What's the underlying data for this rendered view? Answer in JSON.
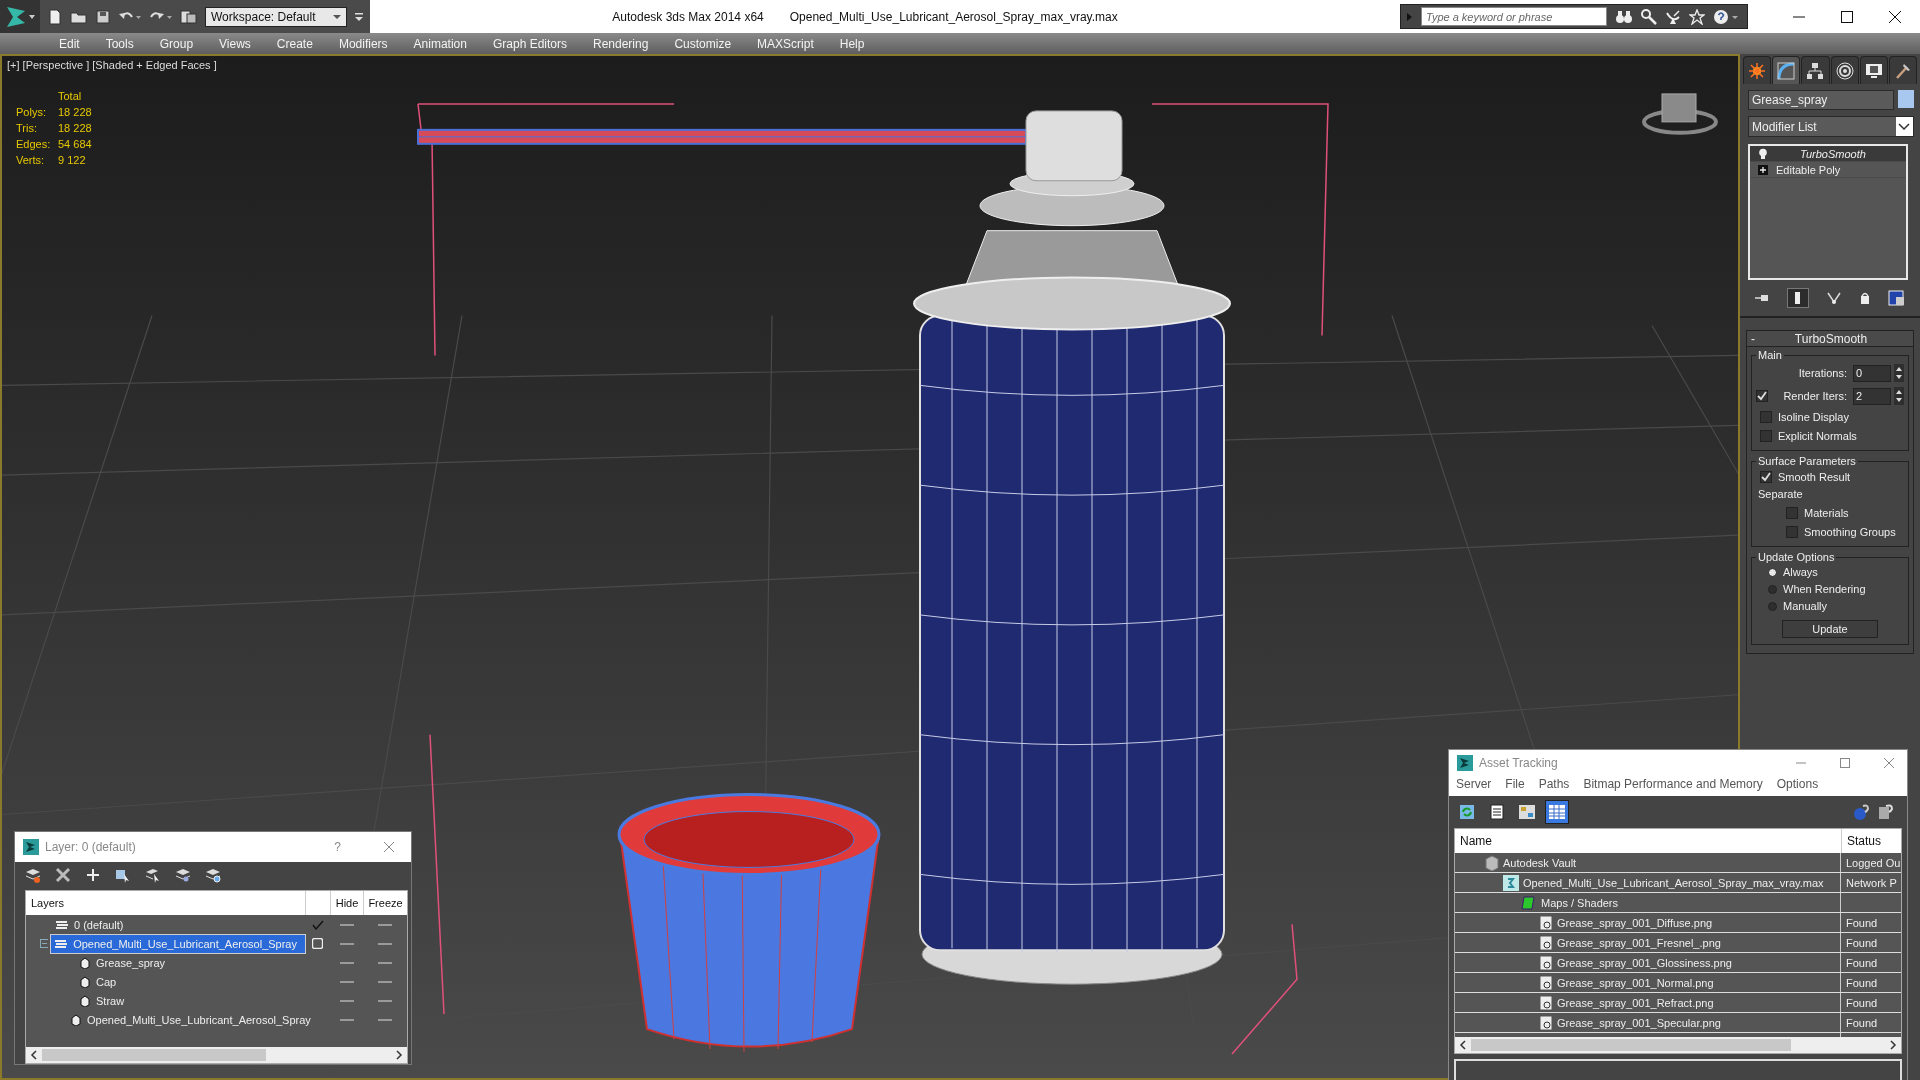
{
  "title_bar": {
    "app": "Autodesk 3ds Max  2014 x64",
    "file": "Opened_Multi_Use_Lubricant_Aerosol_Spray_max_vray.max",
    "workspace": "Workspace: Default",
    "search": {
      "placeholder": "Type a keyword or phrase"
    }
  },
  "menu": [
    "Edit",
    "Tools",
    "Group",
    "Views",
    "Create",
    "Modifiers",
    "Animation",
    "Graph Editors",
    "Rendering",
    "Customize",
    "MAXScript",
    "Help"
  ],
  "viewport": {
    "label": "[+] [Perspective ] [Shaded + Edged Faces ]",
    "stats": {
      "header": "Total",
      "rows": [
        {
          "label": "Polys:",
          "value": "18 228"
        },
        {
          "label": "Tris:",
          "value": "18 228"
        },
        {
          "label": "Edges:",
          "value": "54 684"
        },
        {
          "label": "Verts:",
          "value": "9 122"
        }
      ]
    }
  },
  "command_panel": {
    "tabs": [
      {
        "kind": "create",
        "selected": false
      },
      {
        "kind": "modify",
        "selected": true
      },
      {
        "kind": "hierarchy",
        "selected": false
      },
      {
        "kind": "motion",
        "selected": false
      },
      {
        "kind": "display",
        "selected": false
      },
      {
        "kind": "utilities",
        "selected": false
      }
    ],
    "object_name": "Grease_spray",
    "modifier_list": "Modifier List",
    "stack": [
      {
        "kind": "modifier",
        "label": "TurboSmooth",
        "selected": true
      },
      {
        "kind": "object",
        "label": "Editable Poly",
        "selected": false
      }
    ],
    "rollout": {
      "collapse": "-",
      "title": "TurboSmooth",
      "groups": [
        {
          "title": "Main",
          "items": [
            {
              "kind": "spinner",
              "label": "Iterations:",
              "value": "0"
            },
            {
              "kind": "check_spinner",
              "label": "Render Iters:",
              "checked": true,
              "value": "2"
            },
            {
              "kind": "checkbox",
              "label": "Isoline Display",
              "checked": false
            },
            {
              "kind": "checkbox",
              "label": "Explicit Normals",
              "checked": false
            }
          ]
        },
        {
          "title": "Surface Parameters",
          "items": [
            {
              "kind": "checkbox",
              "label": "Smooth Result",
              "checked": true
            },
            {
              "kind": "label",
              "label": "Separate"
            },
            {
              "kind": "sub_checkbox",
              "label": "Materials",
              "checked": false
            },
            {
              "kind": "sub_checkbox",
              "label": "Smoothing Groups",
              "checked": false
            }
          ]
        },
        {
          "title": "Update Options",
          "items": [
            {
              "kind": "radio",
              "label": "Always",
              "selected": true
            },
            {
              "kind": "radio",
              "label": "When Rendering",
              "selected": false
            },
            {
              "kind": "radio",
              "label": "Manually",
              "selected": false
            },
            {
              "kind": "button",
              "label": "Update"
            }
          ]
        }
      ]
    }
  },
  "layer_dialog": {
    "title": "Layer: 0 (default)",
    "help": "?",
    "columns": [
      "Layers",
      "Hide",
      "Freeze"
    ],
    "rows": [
      {
        "kind": "layer",
        "name": "0 (default)",
        "current": true,
        "selected": false,
        "hidden": false,
        "frozen": false
      },
      {
        "kind": "layer",
        "name": "Opened_Multi_Use_Lubricant_Aerosol_Spray",
        "current": false,
        "selected": true,
        "expanded": true,
        "hidden": false,
        "frozen": false,
        "children": [
          {
            "kind": "object",
            "name": "Grease_spray",
            "selected": false,
            "hidden": false,
            "frozen": false
          },
          {
            "kind": "object",
            "name": "Cap",
            "selected": false,
            "hidden": false,
            "frozen": false
          },
          {
            "kind": "object",
            "name": "Straw",
            "selected": false,
            "hidden": false,
            "frozen": false
          },
          {
            "kind": "object",
            "name": "Opened_Multi_Use_Lubricant_Aerosol_Spray",
            "selected": false,
            "hidden": false,
            "frozen": false
          }
        ]
      }
    ]
  },
  "asset_tracking": {
    "title": "Asset Tracking",
    "menu": [
      "Server",
      "File",
      "Paths",
      "Bitmap Performance and Memory",
      "Options"
    ],
    "toolbar": [
      {
        "kind": "refresh",
        "selected": false
      },
      {
        "kind": "list",
        "selected": false
      },
      {
        "kind": "thumbnails",
        "selected": false
      },
      {
        "kind": "table",
        "selected": true
      }
    ],
    "columns": [
      "Name",
      "Status"
    ],
    "rows": [
      {
        "kind": "vault",
        "name": "Autodesk Vault",
        "status": "Logged Ou",
        "children": [
          {
            "kind": "max_file",
            "name": "Opened_Multi_Use_Lubricant_Aerosol_Spray_max_vray.max",
            "status": "Network P",
            "children": [
              {
                "kind": "folder",
                "name": "Maps / Shaders",
                "children": [
                  {
                    "kind": "bitmap",
                    "name": "Grease_spray_001_Diffuse.png",
                    "status": "Found"
                  },
                  {
                    "kind": "bitmap",
                    "name": "Grease_spray_001_Fresnel_.png",
                    "status": "Found"
                  },
                  {
                    "kind": "bitmap",
                    "name": "Grease_spray_001_Glossiness.png",
                    "status": "Found"
                  },
                  {
                    "kind": "bitmap",
                    "name": "Grease_spray_001_Normal.png",
                    "status": "Found"
                  },
                  {
                    "kind": "bitmap",
                    "name": "Grease_spray_001_Refract.png",
                    "status": "Found"
                  },
                  {
                    "kind": "bitmap",
                    "name": "Grease_spray_001_Specular.png",
                    "status": "Found"
                  }
                ]
              }
            ]
          }
        ]
      }
    ]
  }
}
